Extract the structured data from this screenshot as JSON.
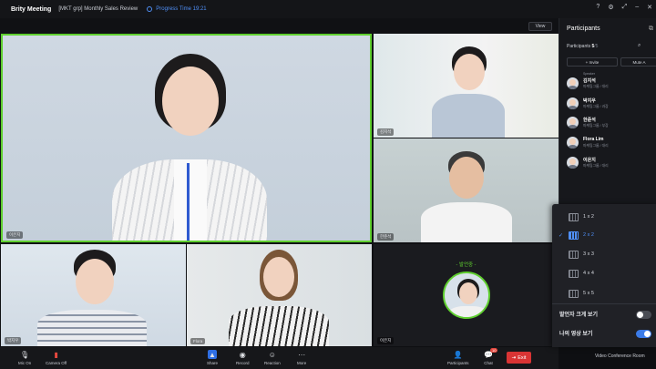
{
  "app": {
    "brand": "Brity Meeting",
    "meeting_title": "[MKT grp] Monthly Sales Review",
    "progress_time": "Progress Time 19:21"
  },
  "stage": {
    "view_label": "View",
    "tiles": [
      {
        "name": "이은지",
        "speaking": true
      },
      {
        "name": "김지석"
      },
      {
        "name": "한준석"
      },
      {
        "name": "박지우"
      },
      {
        "name": "Flora"
      },
      {
        "name": "이은지",
        "speaker_label": "- 발언중 -"
      }
    ]
  },
  "bottombar": {
    "mic": "Mic On",
    "camera": "Camera Off",
    "share": "Share",
    "record": "Record",
    "reaction": "Reaction",
    "more": "More",
    "participants": "Participants",
    "chat": "Chat",
    "chat_badge": "10",
    "exit": "Exit",
    "room": "Video Conference Room"
  },
  "panel": {
    "title": "Participants",
    "count_label": "Participants",
    "count": "5",
    "total": "/5",
    "invite": "+ Invite",
    "mute_all": "Mute A",
    "participants": [
      {
        "role": "Speaker",
        "name": "김지석",
        "sub": "마케팅그룹 / 대리"
      },
      {
        "role": "",
        "name": "박지우",
        "sub": "마케팅그룹 / 과장"
      },
      {
        "role": "",
        "name": "한준석",
        "sub": "마케팅그룹 / 부장"
      },
      {
        "role": "",
        "name": "Flora Lim",
        "sub": "마케팅그룹 / 대리"
      },
      {
        "role": "",
        "name": "이은지",
        "sub": "마케팅그룹 / 대리"
      }
    ]
  },
  "layout_menu": {
    "options": [
      "1 x 2",
      "2 x 2",
      "3 x 3",
      "4 x 4",
      "5 x 5"
    ],
    "selected": "2 x 2",
    "toggle_speaker_large": "발언자 크게 보기",
    "toggle_speaker_large_on": false,
    "toggle_my_video": "나의 영상 보기",
    "toggle_my_video_on": true
  },
  "colors": {
    "speaking_border": "#5fcf2f",
    "accent": "#4f8ff7",
    "exit": "#d93434"
  }
}
